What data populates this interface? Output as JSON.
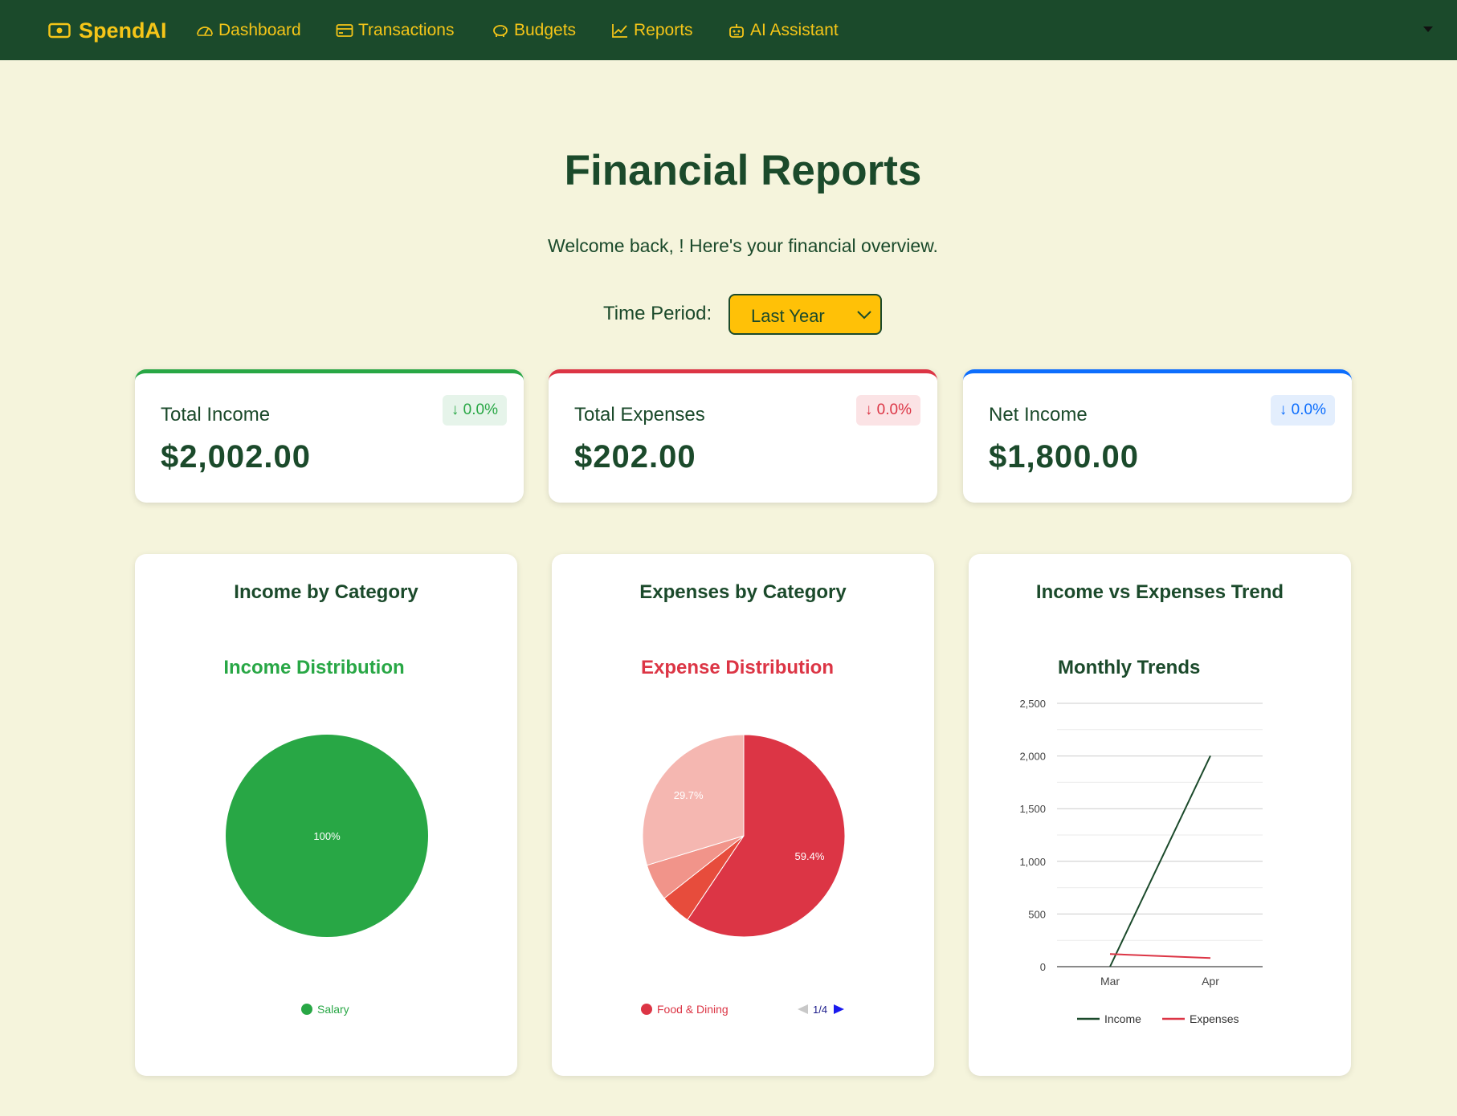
{
  "nav": {
    "brand": "SpendAI",
    "items": [
      {
        "label": "Dashboard",
        "icon": "speedometer-icon"
      },
      {
        "label": "Transactions",
        "icon": "credit-card-icon"
      },
      {
        "label": "Budgets",
        "icon": "piggy-bank-icon"
      },
      {
        "label": "Reports",
        "icon": "graph-up-icon"
      },
      {
        "label": "AI Assistant",
        "icon": "robot-icon"
      }
    ]
  },
  "header": {
    "title": "Financial Reports",
    "welcome": "Welcome back, ! Here's your financial overview."
  },
  "period": {
    "label": "Time Period:",
    "selected": "Last Year"
  },
  "stats": [
    {
      "label": "Total Income",
      "amount": "$2,002.00",
      "change": "↓ 0.0%",
      "accent": "#28a745"
    },
    {
      "label": "Total Expenses",
      "amount": "$202.00",
      "change": "↓ 0.0%",
      "accent": "#dc3545"
    },
    {
      "label": "Net Income",
      "amount": "$1,800.00",
      "change": "↓ 0.0%",
      "accent": "#0d6efd"
    }
  ],
  "chart_data": [
    {
      "type": "pie",
      "card_title": "Income by Category",
      "title": "Income Distribution",
      "categories": [
        "Salary"
      ],
      "values": [
        100
      ],
      "slice_labels": [
        "100%"
      ],
      "legend": [
        "Salary"
      ],
      "colors": [
        "#28a745"
      ]
    },
    {
      "type": "pie",
      "card_title": "Expenses by Category",
      "title": "Expense Distribution",
      "categories": [
        "Food & Dining",
        "",
        "",
        ""
      ],
      "values": [
        59.4,
        5.0,
        5.9,
        29.7
      ],
      "slice_labels": [
        "59.4%",
        "",
        "",
        "29.7%"
      ],
      "legend": [
        "Food & Dining"
      ],
      "legend_page": "1/4",
      "colors": [
        "#dc3545",
        "#e74c3c",
        "#f1948a",
        "#f5b7b1"
      ]
    },
    {
      "type": "line",
      "card_title": "Income vs Expenses Trend",
      "title": "Monthly Trends",
      "x": [
        "Mar",
        "Apr"
      ],
      "ylim": [
        0,
        2500
      ],
      "yticks": [
        "0",
        "500",
        "1,000",
        "1,500",
        "2,000",
        "2,500"
      ],
      "series": [
        {
          "name": "Income",
          "values": [
            0,
            2002
          ],
          "color": "#1b4a2b"
        },
        {
          "name": "Expenses",
          "values": [
            120,
            82
          ],
          "color": "#dc3545"
        }
      ],
      "grid": true,
      "legend_position": "bottom"
    }
  ]
}
